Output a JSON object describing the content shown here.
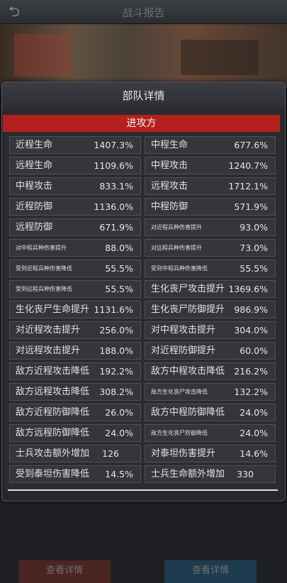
{
  "header": {
    "title": "战斗报告"
  },
  "dialog": {
    "title": "部队详情",
    "side_label": "进攻方",
    "rows": [
      {
        "left": {
          "label": "近程生命",
          "value": "1407.3%"
        },
        "right": {
          "label": "中程生命",
          "value": "677.6%"
        }
      },
      {
        "left": {
          "label": "远程生命",
          "value": "1109.6%"
        },
        "right": {
          "label": "中程攻击",
          "value": "1240.7%"
        }
      },
      {
        "left": {
          "label": "中程攻击",
          "value": "833.1%"
        },
        "right": {
          "label": "远程攻击",
          "value": "1712.1%"
        }
      },
      {
        "left": {
          "label": "近程防御",
          "value": "1136.0%"
        },
        "right": {
          "label": "中程防御",
          "value": "571.9%"
        }
      },
      {
        "left": {
          "label": "远程防御",
          "value": "671.9%"
        },
        "right": {
          "label": "对近程兵种伤害提升",
          "value": "93.0%"
        }
      },
      {
        "left": {
          "label": "对中程兵种伤害提升",
          "value": "88.0%"
        },
        "right": {
          "label": "对远程兵种伤害提升",
          "value": "73.0%"
        }
      },
      {
        "left": {
          "label": "受到近程兵种伤害降低",
          "value": "55.5%"
        },
        "right": {
          "label": "受到中程兵种伤害降低",
          "value": "55.5%"
        }
      },
      {
        "left": {
          "label": "受到远程兵种伤害降低",
          "value": "55.5%"
        },
        "right": {
          "label": "生化丧尸攻击提升",
          "value": "1369.6%"
        }
      },
      {
        "left": {
          "label": "生化丧尸生命提升",
          "value": "1131.6%"
        },
        "right": {
          "label": "生化丧尸防御提升",
          "value": "986.9%"
        }
      },
      {
        "left": {
          "label": "对近程攻击提升",
          "value": "256.0%"
        },
        "right": {
          "label": "对中程攻击提升",
          "value": "304.0%"
        }
      },
      {
        "left": {
          "label": "对远程攻击提升",
          "value": "188.0%"
        },
        "right": {
          "label": "对近程防御提升",
          "value": "60.0%"
        }
      },
      {
        "left": {
          "label": "敌方近程攻击降低",
          "value": "192.2%"
        },
        "right": {
          "label": "敌方中程攻击降低",
          "value": "216.2%"
        }
      },
      {
        "left": {
          "label": "敌方远程攻击降低",
          "value": "308.2%"
        },
        "right": {
          "label": "敌方生化丧尸攻击降低",
          "value": "132.2%"
        }
      },
      {
        "left": {
          "label": "敌方近程防御降低",
          "value": "26.0%"
        },
        "right": {
          "label": "敌方中程防御降低",
          "value": "24.0%"
        }
      },
      {
        "left": {
          "label": "敌方远程防御降低",
          "value": "24.0%"
        },
        "right": {
          "label": "敌方生化丧尸防御降低",
          "value": "24.0%"
        }
      },
      {
        "left": {
          "label": "士兵攻击额外增加",
          "value": "126"
        },
        "right": {
          "label": "对泰坦伤害提升",
          "value": "14.6%"
        }
      },
      {
        "left": {
          "label": "受到泰坦伤害降低",
          "value": "14.5%"
        },
        "right": {
          "label": "士兵生命额外增加",
          "value": "330"
        }
      }
    ]
  },
  "footer": {
    "left_button": "查看详情",
    "right_button": "查看详情"
  }
}
